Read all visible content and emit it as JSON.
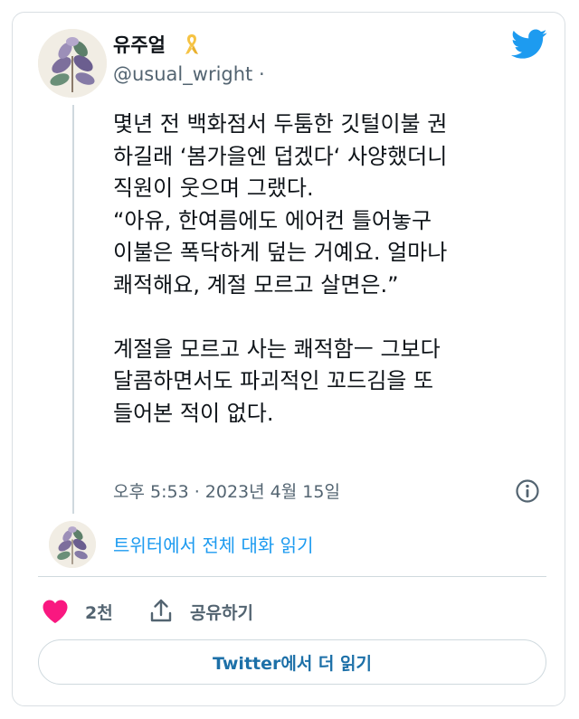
{
  "tweet": {
    "display_name": "유주얼",
    "handle": "@usual_wright ·",
    "text_lines": [
      "몇년 전 백화점서 두툼한 깃털이불 권",
      "하길래 ‘봄가을엔 덥겠다‘ 사양했더니",
      "직원이 웃으며 그랬다.",
      "“아유, 한여름에도 에어컨 틀어놓구",
      "이불은 폭닥하게 덮는 거예요. 얼마나",
      "쾌적해요, 계절 모르고 살면은.”",
      "",
      "계절을 모르고 사는 쾌적함ㅡ 그보다",
      "달콤하면서도 파괴적인 꼬드김을 또",
      "들어본 적이 없다."
    ],
    "timestamp": "오후 5:53 · 2023년 4월 15일"
  },
  "thread": {
    "read_conversation_label": "트위터에서 전체 대화 읽기"
  },
  "actions": {
    "like_count": "2천",
    "share_label": "공유하기"
  },
  "footer": {
    "read_more_label": "Twitter에서 더 읽기"
  },
  "icons": {
    "ribbon": "yellow-ribbon-icon",
    "logo": "twitter-bird-icon",
    "info": "info-icon",
    "like": "heart-icon",
    "share": "share-icon"
  },
  "colors": {
    "accent_blue": "#1d9bf0",
    "heart_pink": "#f91880",
    "ribbon_yellow": "#f6c343",
    "text_primary": "#0f1419",
    "text_secondary": "#536471"
  }
}
